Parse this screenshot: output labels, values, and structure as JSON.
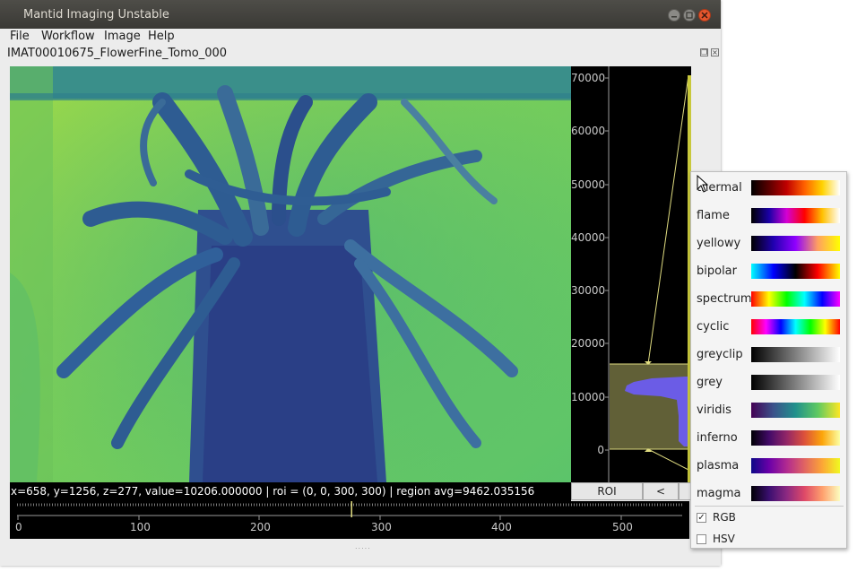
{
  "window": {
    "title": "Mantid Imaging Unstable"
  },
  "menus": [
    "File",
    "Workflow",
    "Image",
    "Help"
  ],
  "document": {
    "title": "IMAT00010675_FlowerFine_Tomo_000"
  },
  "status": {
    "text": "x=658, y=1256, z=277, value=10206.000000 | roi = (0, 0, 300, 300) | region avg=9462.035156",
    "roi_button": "ROI",
    "prev_button": "<"
  },
  "histogram": {
    "ticks": [
      "70000",
      "60000",
      "50000",
      "40000",
      "30000",
      "20000",
      "10000",
      "0"
    ]
  },
  "slider": {
    "labels": [
      "0",
      "100",
      "200",
      "300",
      "400",
      "500"
    ],
    "position_fraction": 0.503
  },
  "colormaps": [
    {
      "name": "thermal",
      "colors": [
        "#000000",
        "#5a0000",
        "#c00000",
        "#ff6000",
        "#ffd200",
        "#ffffff"
      ]
    },
    {
      "name": "flame",
      "colors": [
        "#000000",
        "#1a00a6",
        "#d400d4",
        "#ff0000",
        "#ffc000",
        "#ffffff"
      ]
    },
    {
      "name": "yellowy",
      "colors": [
        "#000000",
        "#2000b0",
        "#9000ff",
        "#ffa060",
        "#ffff00"
      ]
    },
    {
      "name": "bipolar",
      "colors": [
        "#00ffff",
        "#0000ff",
        "#000000",
        "#ff0000",
        "#ffff00"
      ]
    },
    {
      "name": "spectrum",
      "colors": [
        "#ff0000",
        "#ffff00",
        "#00ff00",
        "#00ffff",
        "#0000ff",
        "#ff00ff"
      ]
    },
    {
      "name": "cyclic",
      "colors": [
        "#ff0000",
        "#ff00ff",
        "#0000ff",
        "#00ffff",
        "#00ff00",
        "#ffff00",
        "#ff0000"
      ]
    },
    {
      "name": "greyclip",
      "colors": [
        "#000000",
        "#ffffff"
      ]
    },
    {
      "name": "grey",
      "colors": [
        "#000000",
        "#ffffff"
      ]
    },
    {
      "name": "viridis",
      "colors": [
        "#440154",
        "#3b528b",
        "#21918c",
        "#5ec962",
        "#fde725"
      ]
    },
    {
      "name": "inferno",
      "colors": [
        "#000004",
        "#420a68",
        "#932667",
        "#dd513a",
        "#fca50a",
        "#fcffa4"
      ]
    },
    {
      "name": "plasma",
      "colors": [
        "#0d0887",
        "#6a00a8",
        "#b12a90",
        "#e16462",
        "#fca636",
        "#f0f921"
      ]
    },
    {
      "name": "magma",
      "colors": [
        "#000004",
        "#3b0f70",
        "#8c2981",
        "#de4968",
        "#fe9f6d",
        "#fcfdbf"
      ]
    }
  ],
  "options": [
    {
      "label": "RGB",
      "checked": true
    },
    {
      "label": "HSV",
      "checked": false
    }
  ]
}
